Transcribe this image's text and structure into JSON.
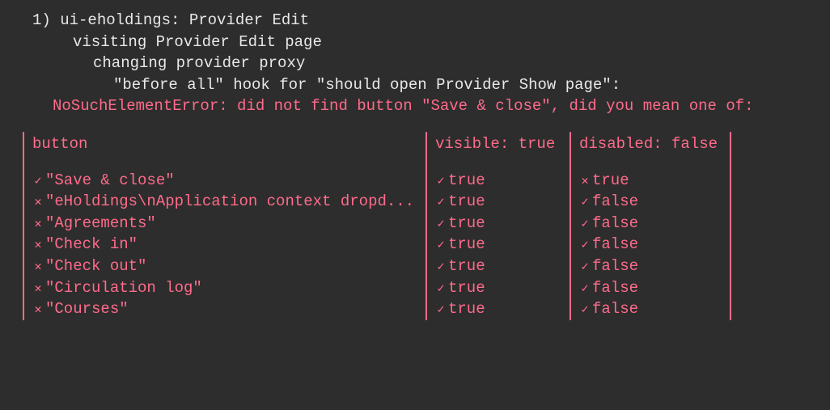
{
  "test": {
    "number": "1)",
    "suite": "ui-eholdings: Provider Edit",
    "context1": "visiting Provider Edit page",
    "context2": "changing provider proxy",
    "hook": "\"before all\" hook for \"should open Provider Show page\":"
  },
  "error": "NoSuchElementError: did not find button \"Save & close\", did you mean one of:",
  "table": {
    "headers": {
      "button": "button",
      "visible": "visible: true",
      "disabled": "disabled: false"
    },
    "rows": [
      {
        "buttonOk": true,
        "button": "\"Save & close\"",
        "visibleOk": true,
        "visible": "true",
        "disabledOk": false,
        "disabled": "true"
      },
      {
        "buttonOk": false,
        "button": "\"eHoldings\\nApplication context dropd...",
        "visibleOk": true,
        "visible": "true",
        "disabledOk": true,
        "disabled": "false"
      },
      {
        "buttonOk": false,
        "button": "\"Agreements\"",
        "visibleOk": true,
        "visible": "true",
        "disabledOk": true,
        "disabled": "false"
      },
      {
        "buttonOk": false,
        "button": "\"Check in\"",
        "visibleOk": true,
        "visible": "true",
        "disabledOk": true,
        "disabled": "false"
      },
      {
        "buttonOk": false,
        "button": "\"Check out\"",
        "visibleOk": true,
        "visible": "true",
        "disabledOk": true,
        "disabled": "false"
      },
      {
        "buttonOk": false,
        "button": "\"Circulation log\"",
        "visibleOk": true,
        "visible": "true",
        "disabledOk": true,
        "disabled": "false"
      },
      {
        "buttonOk": false,
        "button": "\"Courses\"",
        "visibleOk": true,
        "visible": "true",
        "disabledOk": true,
        "disabled": "false"
      }
    ]
  }
}
